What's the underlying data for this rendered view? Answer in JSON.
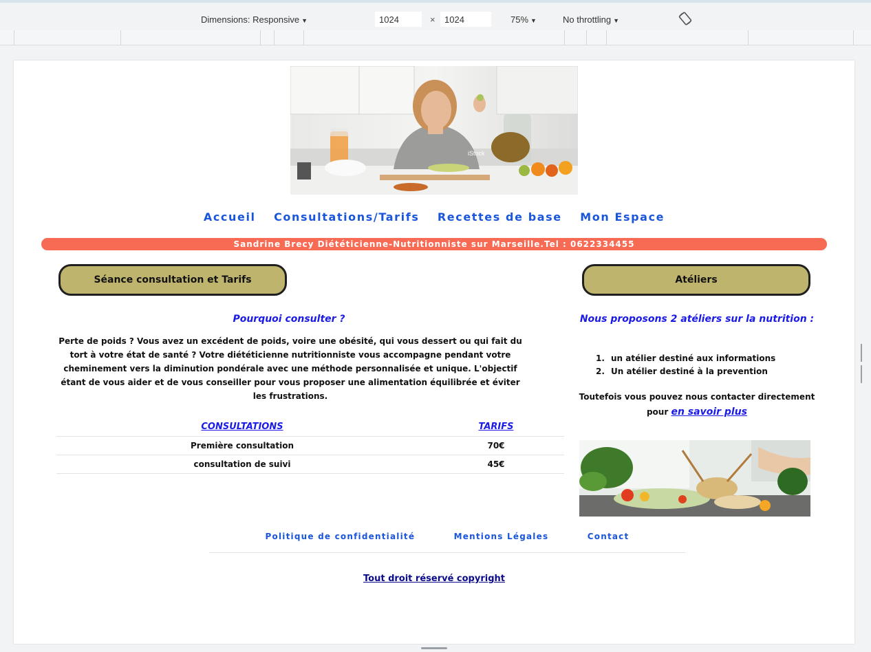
{
  "devtools": {
    "dimensions_label": "Dimensions: Responsive",
    "width": "1024",
    "times": "×",
    "height": "1024",
    "zoom": "75%",
    "throttling": "No throttling"
  },
  "nav": {
    "items": [
      "Accueil",
      "Consultations/Tarifs",
      "Recettes de base",
      "Mon Espace"
    ]
  },
  "banner": "Sandrine Brecy Diététicienne-Nutritionniste sur Marseille.Tel : 0622334455",
  "left": {
    "pill": "Séance consultation et Tarifs",
    "why_title": "Pourquoi consulter ?",
    "intro": "Perte de poids ? Vous avez un excédent de poids, voire une obésité, qui vous dessert ou qui fait du tort à votre état de santé ? Votre diététicienne nutritionniste vous accompagne pendant votre cheminement vers la diminution pondérale avec une méthode personnalisée et unique. L'objectif étant de vous aider et de vous conseiller pour vous proposer une alimentation équilibrée et éviter les frustrations.",
    "table": {
      "headers": [
        "CONSULTATIONS",
        "TARIFS"
      ],
      "rows": [
        [
          "Première consultation",
          "70€"
        ],
        [
          "consultation de suivi",
          "45€"
        ]
      ]
    }
  },
  "right": {
    "pill": "Atéliers",
    "title": "Nous proposons 2 atéliers sur la nutrition :",
    "list": [
      {
        "num": "1.",
        "text": "un atélier destiné aux informations"
      },
      {
        "num": "2.",
        "text": "Un atélier destiné à la prevention"
      }
    ],
    "contact_text": "Toutefois vous pouvez nous contacter directement pour",
    "contact_link": "en savoir plus"
  },
  "hero": {
    "watermark": "iStock"
  },
  "footer": {
    "links": [
      "Politique de confidentialité",
      "Mentions Légales",
      "Contact"
    ],
    "copyright": "Tout droit réservé copyright"
  },
  "colors": {
    "nav_link": "#1a56db",
    "banner": "#f76b55",
    "pill": "#bfb46d",
    "heading_blue": "#1a1ae6"
  }
}
